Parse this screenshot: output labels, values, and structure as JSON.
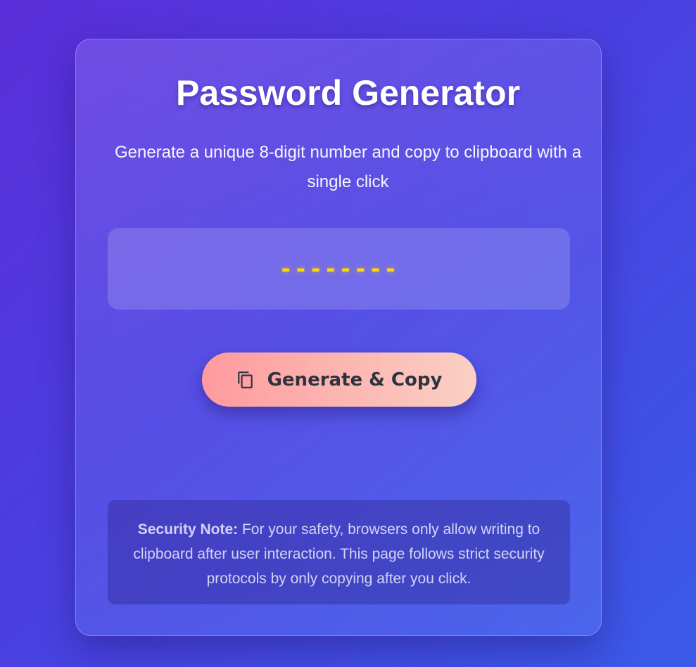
{
  "header": {
    "title": "Password Generator",
    "subtitle": "Generate a unique 8-digit number and copy to clipboard with a single click"
  },
  "display": {
    "value": "--------"
  },
  "action": {
    "button_label": "Generate & Copy",
    "button_icon": "copy-icon"
  },
  "note": {
    "label": "Security Note:",
    "text": " For your safety, browsers only allow writing to clipboard after user interaction. This page follows strict security protocols by only copying after you click."
  },
  "colors": {
    "digits": "#ffd700",
    "button_start": "#ff9a9e",
    "button_end": "#fad0c4",
    "button_text": "#2d3440"
  }
}
